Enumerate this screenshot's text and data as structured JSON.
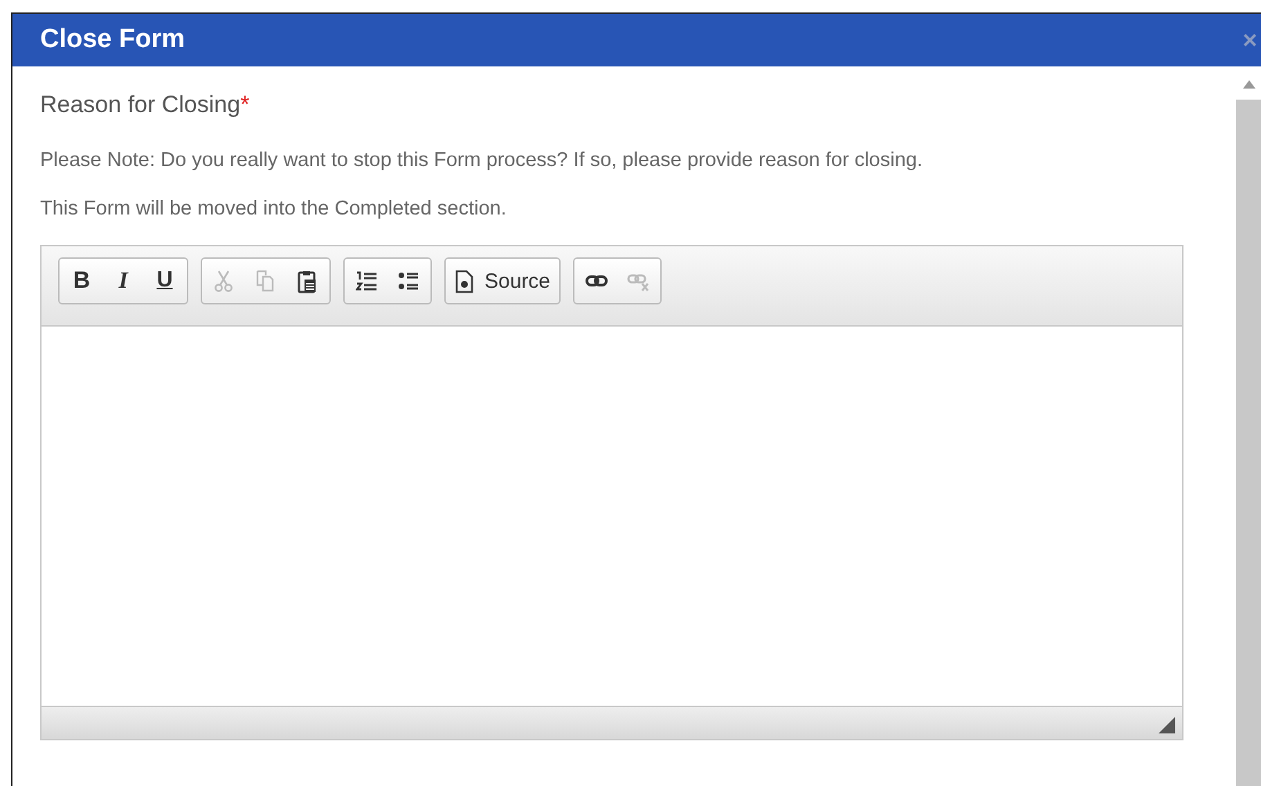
{
  "dialog": {
    "title": "Close Form",
    "close": "×"
  },
  "field": {
    "label": "Reason for Closing",
    "required": true,
    "required_mark": "*"
  },
  "notes": [
    "Please Note: Do you really want to stop this Form process? If so, please provide reason for closing.",
    "This Form will be moved into the Completed section."
  ],
  "toolbar": [
    {
      "buttons": [
        {
          "kind": "bold",
          "label": "B",
          "disabled": false
        },
        {
          "kind": "italic",
          "label": "I",
          "disabled": false
        },
        {
          "kind": "underline",
          "label": "U",
          "disabled": false
        }
      ]
    },
    {
      "buttons": [
        {
          "kind": "cut",
          "disabled": true
        },
        {
          "kind": "copy",
          "disabled": true
        },
        {
          "kind": "paste",
          "disabled": false
        }
      ]
    },
    {
      "buttons": [
        {
          "kind": "numbered",
          "disabled": false
        },
        {
          "kind": "bulleted",
          "disabled": false
        }
      ]
    },
    {
      "buttons": [
        {
          "kind": "source",
          "label": "Source",
          "disabled": false
        }
      ]
    },
    {
      "buttons": [
        {
          "kind": "link",
          "disabled": false
        },
        {
          "kind": "unlink",
          "disabled": true
        }
      ]
    }
  ]
}
